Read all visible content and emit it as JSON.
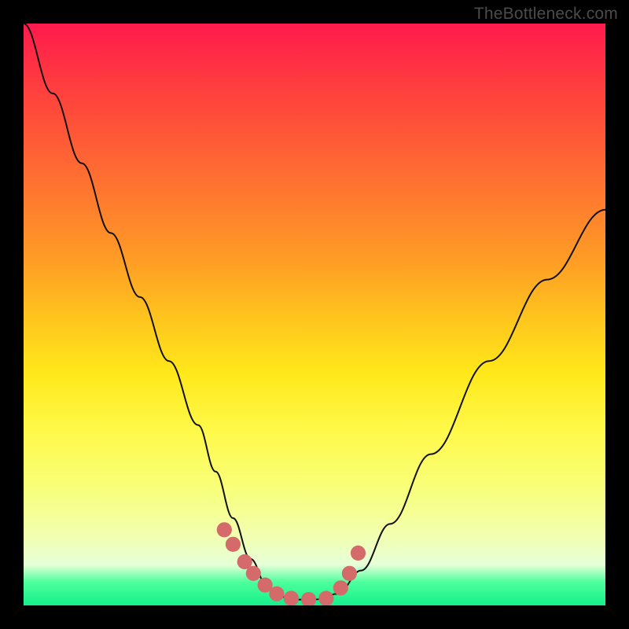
{
  "watermark": "TheBottleneck.com",
  "chart_data": {
    "type": "line",
    "title": "",
    "xlabel": "",
    "ylabel": "",
    "xlim": [
      0,
      1
    ],
    "ylim": [
      0,
      1
    ],
    "series": [
      {
        "name": "curve",
        "x": [
          0.0,
          0.05,
          0.1,
          0.15,
          0.2,
          0.25,
          0.3,
          0.33,
          0.36,
          0.39,
          0.42,
          0.46,
          0.5,
          0.54,
          0.58,
          0.63,
          0.7,
          0.8,
          0.9,
          1.0
        ],
        "values": [
          1.0,
          0.88,
          0.76,
          0.64,
          0.53,
          0.42,
          0.31,
          0.23,
          0.15,
          0.08,
          0.03,
          0.01,
          0.01,
          0.02,
          0.06,
          0.14,
          0.26,
          0.42,
          0.56,
          0.68
        ]
      }
    ],
    "markers": {
      "name": "highlight-dots",
      "x": [
        0.345,
        0.36,
        0.38,
        0.395,
        0.415,
        0.435,
        0.46,
        0.49,
        0.52,
        0.545,
        0.56,
        0.575
      ],
      "values": [
        0.13,
        0.105,
        0.075,
        0.055,
        0.035,
        0.02,
        0.012,
        0.01,
        0.012,
        0.03,
        0.055,
        0.09
      ],
      "r": 0.013
    }
  }
}
